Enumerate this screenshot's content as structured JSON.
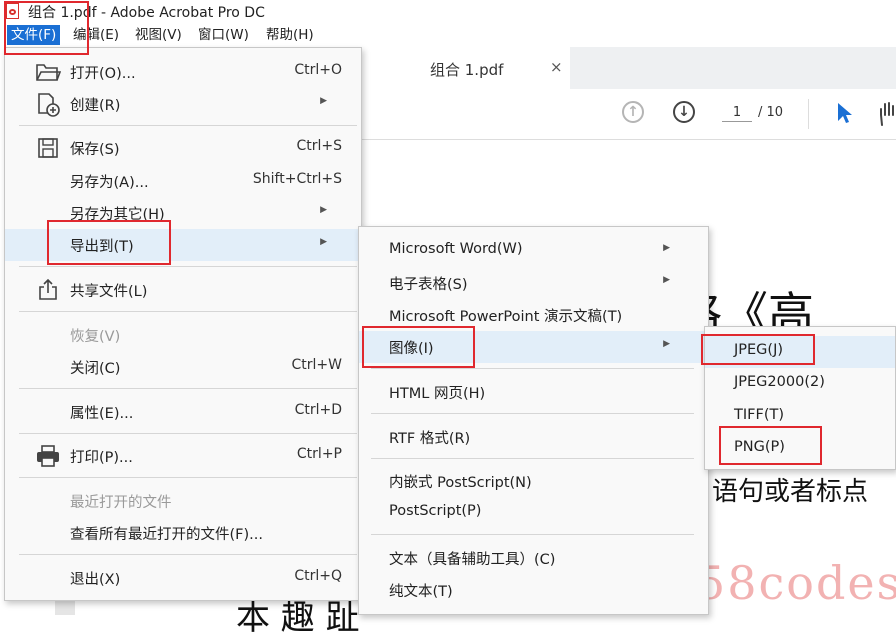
{
  "window": {
    "title": "组合 1.pdf - Adobe Acrobat Pro DC"
  },
  "menubar": [
    "文件(F)",
    "编辑(E)",
    "视图(V)",
    "窗口(W)",
    "帮助(H)"
  ],
  "tab": {
    "title": "组合 1.pdf",
    "close": "×"
  },
  "toolbar": {
    "page_current": "1",
    "page_total": "/ 10"
  },
  "file_menu": {
    "open": {
      "label": "打开(O)...",
      "shortcut": "Ctrl+O"
    },
    "create": {
      "label": "创建(R)"
    },
    "save": {
      "label": "保存(S)",
      "shortcut": "Ctrl+S"
    },
    "save_as": {
      "label": "另存为(A)...",
      "shortcut": "Shift+Ctrl+S"
    },
    "save_as_other": {
      "label": "另存为其它(H)"
    },
    "export_to": {
      "label": "导出到(T)"
    },
    "share": {
      "label": "共享文件(L)"
    },
    "revert": {
      "label": "恢复(V)"
    },
    "close": {
      "label": "关闭(C)",
      "shortcut": "Ctrl+W"
    },
    "properties": {
      "label": "属性(E)...",
      "shortcut": "Ctrl+D"
    },
    "print": {
      "label": "打印(P)...",
      "shortcut": "Ctrl+P"
    },
    "recent": {
      "label": "最近打开的文件"
    },
    "view_all_recent": {
      "label": "查看所有最近打开的文件(F)..."
    },
    "exit": {
      "label": "退出(X)",
      "shortcut": "Ctrl+Q"
    }
  },
  "export_menu": {
    "word": "Microsoft Word(W)",
    "spreadsheet": "电子表格(S)",
    "powerpoint": "Microsoft PowerPoint 演示文稿(T)",
    "image": "图像(I)",
    "html": "HTML 网页(H)",
    "rtf": "RTF 格式(R)",
    "eps": "内嵌式 PostScript(N)",
    "ps": "PostScript(P)",
    "accessible_text": "文本（具备辅助工具）(C)",
    "plain_text": "纯文本(T)"
  },
  "image_menu": {
    "jpeg": "JPEG(J)",
    "jpeg2000": "JPEG2000(2)",
    "tiff": "TIFF(T)",
    "png": "PNG(P)"
  },
  "document": {
    "large_text": "子格《高",
    "mid_text": "语句或者标点",
    "bottom_text": "本 趣 趾"
  },
  "watermark": "58codes",
  "colors": {
    "menu_active": "#1a6fd4",
    "highlight": "#e2eef9",
    "annotation_red": "#e0282e",
    "pointer_blue": "#1a6fd4"
  }
}
